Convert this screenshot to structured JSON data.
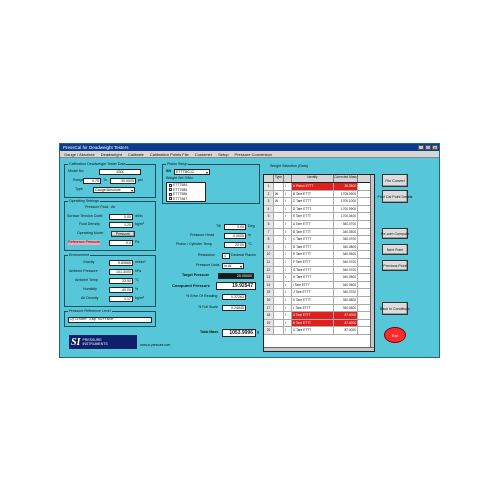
{
  "window": {
    "title": "PressCal for Deadweight Testers",
    "controls": [
      "_",
      "□",
      "x"
    ]
  },
  "menu": [
    "Gauge / Absolute",
    "Deadweight",
    "Calibrate",
    "Calibration Points File",
    "Customer",
    "Setup",
    "Pressure Conversion"
  ],
  "calib": {
    "title": "Calibration Deadweight Tester Data",
    "model_label": "Model No:",
    "model_value": "630L",
    "range_label": "Range",
    "range_from": "0.75",
    "range_to_label": "To",
    "range_to": "30.0000",
    "range_unit": "psi",
    "type_label": "Type",
    "type_value": "Gauge/Absolute"
  },
  "opsettings": {
    "title": "Operating Settings",
    "pressure_fluid_label": "Pressure Fluid:",
    "pressure_fluid_value": "Air",
    "surface_label": "Surface Tension Coeff.",
    "surface_value": "0.00",
    "surface_unit": "lbf/in",
    "fluid_density_label": "Fluid Density",
    "fluid_density_value": "1.20",
    "fluid_density_unit": "kg/m³",
    "mode_label": "Operating Mode:",
    "mode_value": "Pressure",
    "ref_label": "Reference Pressure",
    "ref_value": "0.0",
    "ref_unit": "Pa"
  },
  "environment": {
    "title": "Environment",
    "gravity_label": "Gravity",
    "gravity_value": "9.80665",
    "gravity_unit": "m/sec²",
    "ambient_press_label": "Ambient Pressure",
    "ambient_press_value": "101.3000",
    "ambient_press_unit": "kPa",
    "ambient_temp_label": "Ambient Temp",
    "ambient_temp_value": "23.50",
    "ambient_temp_unit": "°C",
    "humidity_label": "Humidity",
    "humidity_value": "40.00",
    "humidity_unit": "%",
    "air_density_label": "Air Density",
    "air_density_value": "1.17",
    "air_density_unit": "kg/m³"
  },
  "prl": {
    "title": "Pressure Reference Level",
    "value": "Cylinder cap surface"
  },
  "logo": {
    "mark": "SI",
    "line1": "PRESSURE",
    "line2": "INSTRUMENTS",
    "url": "www.si-pressure.com"
  },
  "piston": {
    "title": "Piston Setup",
    "sn_label": "SN",
    "sn_value": "ETTTBC12",
    "wset_label": "Weight Set S/No:",
    "wset_items": [
      "ETTT584",
      "ETTT585",
      "ETTT586",
      "ETTT587"
    ],
    "tilt_label": "Tilt",
    "tilt_value": "0.00",
    "tilt_unit": "Deg",
    "pheight_label": "Pressure Head",
    "pheight_value": "0.0000",
    "pheight_unit": "in",
    "ptemp_label": "Piston / Cylinder Temp",
    "ptemp_value": "20.00",
    "ptemp_unit": "°C",
    "resolution_label": "Resolution",
    "resolution_value": "4",
    "resolution_suffix": "Decimal Places",
    "punits_label": "Pressure Units",
    "punits_value": "in-Al",
    "target_label": "Target Pressure",
    "target_value": "20.00000",
    "computed_label": "Computed Pressure",
    "computed_value": "19.92547",
    "error_label": "% Error Of Reading",
    "error_value": "0.37263",
    "fs_label": "% Full Scale",
    "fs_value": "0.24845",
    "total_label": "Total Mass",
    "total_value": "1053.9996",
    "total_unit": "g"
  },
  "weights": {
    "title": "Weight Selection (Data)",
    "headers": [
      "",
      "Type",
      "",
      "Identity",
      "Corrected Mass"
    ],
    "rows": [
      {
        "n": "1",
        "type": "",
        "f": "I",
        "id": "A Piston ETTT",
        "mass": "35.3900",
        "hl": true
      },
      {
        "n": "2",
        "type": "W",
        "f": "I",
        "id": "B Tare ETTT",
        "mass": "1708.0900",
        "hl": false
      },
      {
        "n": "3",
        "type": "W",
        "f": "I",
        "id": "C Tare ETTT",
        "mass": "1700.1000",
        "hl": false
      },
      {
        "n": "4",
        "type": "",
        "f": "I",
        "id": "D Tare ETTT",
        "mass": "1700.0900",
        "hl": false
      },
      {
        "n": "5",
        "type": "",
        "f": "I",
        "id": "E Tare ETTT",
        "mass": "1700.0400",
        "hl": false
      },
      {
        "n": "6",
        "type": "",
        "f": "I",
        "id": "A Tare ETTT",
        "mass": "340.0700",
        "hl": false
      },
      {
        "n": "7",
        "type": "",
        "f": "I",
        "id": "B Tare ETTT",
        "mass": "340.0500",
        "hl": false
      },
      {
        "n": "8",
        "type": "",
        "f": "I",
        "id": "C Tare ETTT",
        "mass": "340.0700",
        "hl": false
      },
      {
        "n": "9",
        "type": "",
        "f": "I",
        "id": "D Tare ETTT",
        "mass": "340.0800",
        "hl": false
      },
      {
        "n": "10",
        "type": "",
        "f": "I",
        "id": "E Tare ETTT",
        "mass": "340.0600",
        "hl": false
      },
      {
        "n": "11",
        "type": "",
        "f": "I",
        "id": "F Tare ETTT",
        "mass": "340.0700",
        "hl": false
      },
      {
        "n": "12",
        "type": "",
        "f": "I",
        "id": "G Tare ETTT",
        "mass": "340.0700",
        "hl": false
      },
      {
        "n": "13",
        "type": "",
        "f": "I",
        "id": "H Tare ETTT",
        "mass": "340.0500",
        "hl": false
      },
      {
        "n": "14",
        "type": "",
        "f": "I",
        "id": "I Tare ETTT",
        "mass": "340.0600",
        "hl": false
      },
      {
        "n": "15",
        "type": "",
        "f": "I",
        "id": "J Tare ETTT",
        "mass": "340.0700",
        "hl": false
      },
      {
        "n": "16",
        "type": "",
        "f": "I",
        "id": "K Tare ETTT",
        "mass": "340.0800",
        "hl": false
      },
      {
        "n": "17",
        "type": "",
        "f": "I",
        "id": "L Tare ETTT",
        "mass": "340.0600",
        "hl": false
      },
      {
        "n": "18",
        "type": "",
        "f": "I",
        "id": "A Tare ETTT",
        "mass": "87.0000",
        "hl": true
      },
      {
        "n": "19",
        "type": "",
        "f": "I",
        "id": "B Tare ETTT",
        "mass": "87.0000",
        "hl": true
      },
      {
        "n": "20",
        "type": "",
        "f": "I",
        "id": "C Tare ETTT",
        "mass": "87.0000",
        "hl": false
      }
    ]
  },
  "right_buttons": {
    "file_convert": "File Convert",
    "print_cal": "Print Cal Point Details",
    "re_compute": "Re-com Compute",
    "next_point": "Next Point",
    "previous_point": "Previous Point",
    "back_to_conditions": "Back to Conditions",
    "exit": "Exit"
  },
  "colors": {
    "window_bg": "#56c7d8",
    "title_bg": "#0d3c8c",
    "highlight_red": "#e01f1f",
    "exit_red": "#ff2a2a"
  }
}
